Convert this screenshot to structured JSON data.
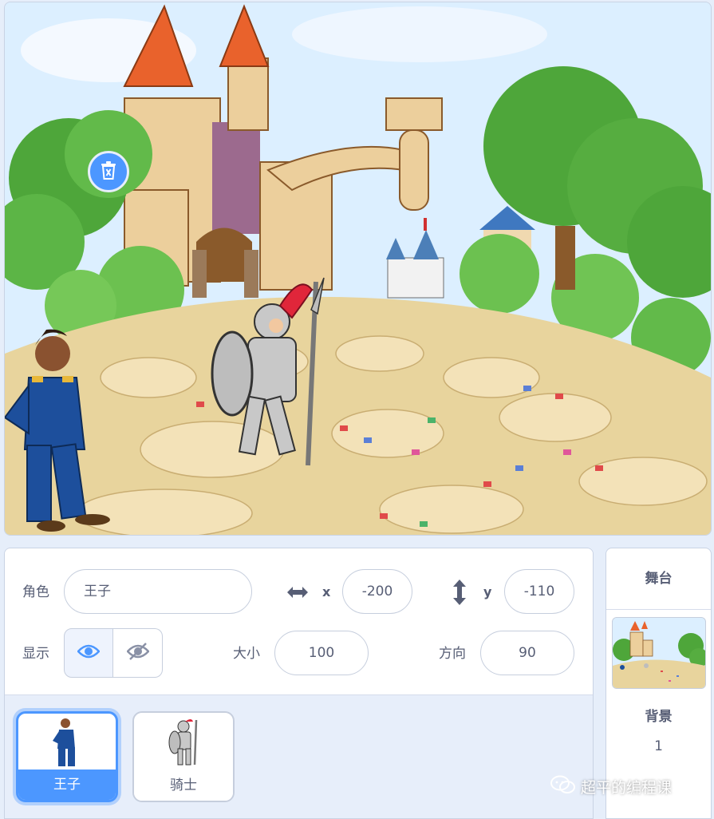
{
  "stage": {
    "sprites": [
      "prince-sprite",
      "knight-sprite"
    ]
  },
  "sprite_info": {
    "sprite_label": "角色",
    "sprite_name": "王子",
    "x_label": "x",
    "x_value": "-200",
    "y_label": "y",
    "y_value": "-110",
    "show_label": "显示",
    "size_label": "大小",
    "size_value": "100",
    "direction_label": "方向",
    "direction_value": "90"
  },
  "sprite_list": [
    {
      "name": "王子",
      "selected": true
    },
    {
      "name": "骑士",
      "selected": false
    }
  ],
  "stage_pane": {
    "title": "舞台",
    "backdrops_label": "背景",
    "backdrops_count": "1"
  },
  "watermark": "超平的编程课",
  "colors": {
    "accent": "#4c97ff",
    "text": "#575e75",
    "panel_bg": "#e7eefa"
  },
  "icons": [
    "horizontal-arrows-icon",
    "vertical-arrows-icon",
    "eye-icon",
    "eye-off-icon",
    "trash-icon",
    "wechat-icon"
  ]
}
